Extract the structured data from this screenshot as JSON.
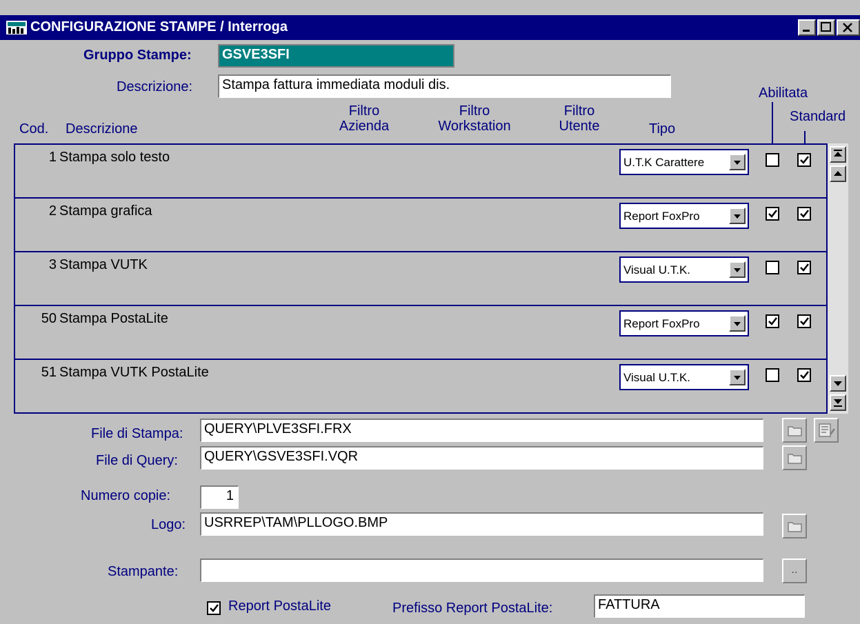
{
  "window": {
    "title": "CONFIGURAZIONE STAMPE / Interroga"
  },
  "header": {
    "gruppo_label": "Gruppo Stampe:",
    "gruppo_value": "GSVE3SFI",
    "descrizione_label": "Descrizione:",
    "descrizione_value": "Stampa fattura immediata moduli dis."
  },
  "columns": {
    "cod": "Cod.",
    "descrizione": "Descrizione",
    "filtro_azienda_1": "Filtro",
    "filtro_azienda_2": "Azienda",
    "filtro_workstation_1": "Filtro",
    "filtro_workstation_2": "Workstation",
    "filtro_utente_1": "Filtro",
    "filtro_utente_2": "Utente",
    "tipo": "Tipo",
    "abilitata": "Abilitata",
    "standard": "Standard"
  },
  "rows": [
    {
      "code": "1",
      "desc": "Stampa solo testo",
      "tipo": "U.T.K Carattere",
      "abilitata": false,
      "standard": true
    },
    {
      "code": "2",
      "desc": "Stampa grafica",
      "tipo": "Report FoxPro",
      "abilitata": true,
      "standard": true
    },
    {
      "code": "3",
      "desc": "Stampa VUTK",
      "tipo": "Visual U.T.K.",
      "abilitata": false,
      "standard": true
    },
    {
      "code": "50",
      "desc": "Stampa PostaLite",
      "tipo": "Report FoxPro",
      "abilitata": true,
      "standard": true
    },
    {
      "code": "51",
      "desc": "Stampa VUTK PostaLite",
      "tipo": "Visual U.T.K.",
      "abilitata": false,
      "standard": true
    }
  ],
  "form": {
    "file_stampa_label": "File di Stampa:",
    "file_stampa_value": "QUERY\\PLVE3SFI.FRX",
    "file_query_label": "File di Query:",
    "file_query_value": "QUERY\\GSVE3SFI.VQR",
    "numero_copie_label": "Numero copie:",
    "numero_copie_value": "1",
    "logo_label": "Logo:",
    "logo_value": "USRREP\\TAM\\PLLOGO.BMP",
    "stampante_label": "Stampante:",
    "stampante_value": "",
    "stampante_btn": "..",
    "report_postalite_label": "Report PostaLite",
    "report_postalite_checked": true,
    "prefisso_label": "Prefisso Report PostaLite:",
    "prefisso_value": "FATTURA"
  },
  "colors": {
    "title_bg": "#000080",
    "label": "#000080",
    "gruppo_bg": "#008080",
    "surface": "#c0c0c0"
  }
}
